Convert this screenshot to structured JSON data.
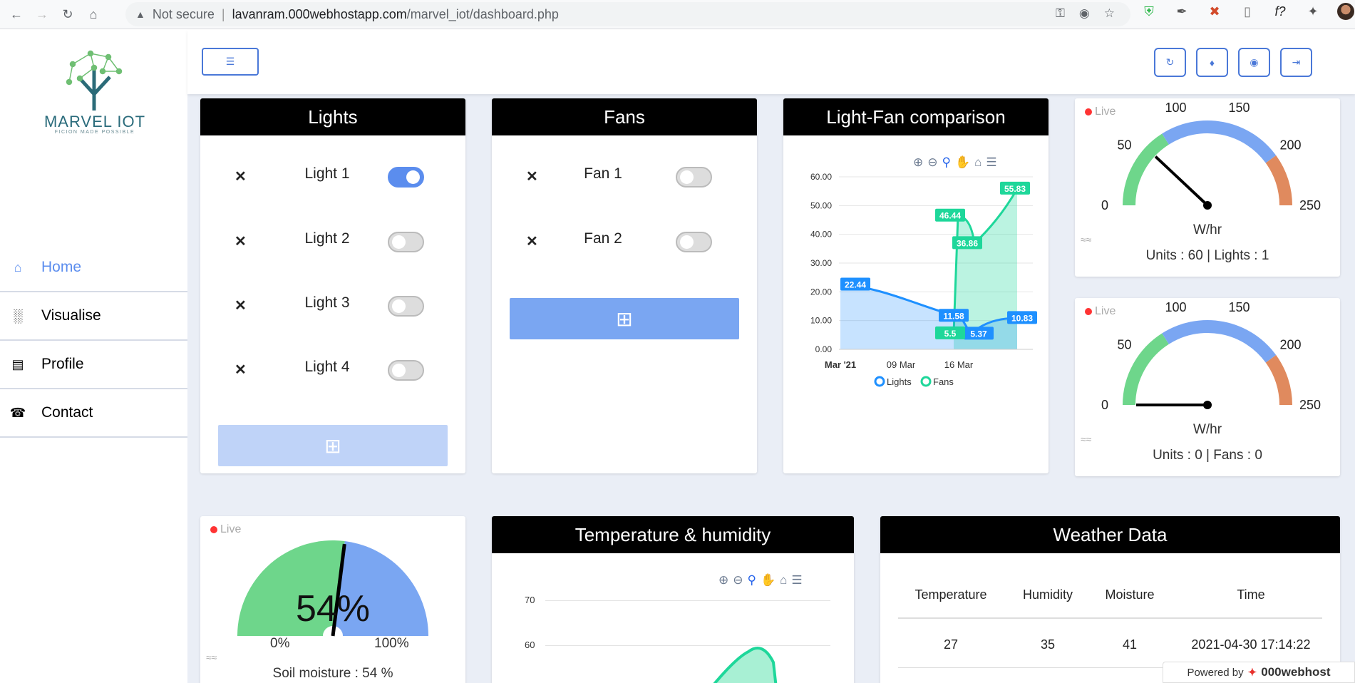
{
  "browser": {
    "security_label": "Not secure",
    "url_host": "lavanram.000webhostapp.com",
    "url_path": "/marvel_iot/dashboard.php"
  },
  "brand": {
    "name": "MARVEL IOT",
    "tagline": "FICION MADE POSSIBLE"
  },
  "sidebar": {
    "items": [
      {
        "label": "Home",
        "icon": "home-icon",
        "active": true
      },
      {
        "label": "Visualise",
        "icon": "bar-chart-icon",
        "active": false
      },
      {
        "label": "Profile",
        "icon": "id-card-icon",
        "active": false
      },
      {
        "label": "Contact",
        "icon": "phone-icon",
        "active": false
      }
    ]
  },
  "lights": {
    "title": "Lights",
    "items": [
      {
        "label": "Light 1",
        "on": true
      },
      {
        "label": "Light 2",
        "on": false
      },
      {
        "label": "Light 3",
        "on": false
      },
      {
        "label": "Light 4",
        "on": false
      }
    ]
  },
  "fans": {
    "title": "Fans",
    "items": [
      {
        "label": "Fan 1",
        "on": false
      },
      {
        "label": "Fan 2",
        "on": false
      }
    ]
  },
  "comparison": {
    "title": "Light-Fan comparison"
  },
  "gauge1": {
    "live": "Live",
    "unit": "W/hr",
    "footer": "Units : 60 | Lights : 1",
    "value": 60,
    "ticks": [
      "0",
      "50",
      "100",
      "150",
      "200",
      "250"
    ]
  },
  "gauge2": {
    "live": "Live",
    "unit": "W/hr",
    "footer": "Units : 0 | Fans : 0",
    "value": 0,
    "ticks": [
      "0",
      "50",
      "100",
      "150",
      "200",
      "250"
    ]
  },
  "soil": {
    "live": "Live",
    "value_label": "54%",
    "min_label": "0%",
    "max_label": "100%",
    "value": 54,
    "footer": "Soil moisture : 54 %"
  },
  "temp_humidity": {
    "title": "Temperature & humidity",
    "y_ticks": [
      "70",
      "60"
    ]
  },
  "weather": {
    "title": "Weather Data",
    "headers": [
      "Temperature",
      "Humidity",
      "Moisture",
      "Time"
    ],
    "rows": [
      [
        "27",
        "35",
        "41",
        "2021-04-30 17:14:22"
      ]
    ]
  },
  "powered_by": {
    "label": "Powered by",
    "brand": "000webhost"
  },
  "colors": {
    "accent": "#5b8dee",
    "lights_series": "#1e90ff",
    "fans_series": "#1ed79a"
  },
  "chart_data": [
    {
      "type": "area",
      "title": "",
      "x": [
        "Mar '21",
        "09 Mar",
        "16 Mar"
      ],
      "y_ticks": [
        "0.00",
        "10.00",
        "20.00",
        "30.00",
        "40.00",
        "50.00",
        "60.00"
      ],
      "ylim": [
        0,
        60
      ],
      "series": [
        {
          "name": "Lights",
          "points": [
            {
              "label": "22.44",
              "y": 22.44
            },
            {
              "label": "11.58",
              "y": 11.58
            },
            {
              "label": "5.37",
              "y": 5.37
            },
            {
              "label": "10.83",
              "y": 10.83
            }
          ]
        },
        {
          "name": "Fans",
          "points": [
            {
              "label": "5.5",
              "y": 5.5
            },
            {
              "label": "46.44",
              "y": 46.44
            },
            {
              "label": "36.86",
              "y": 36.86
            },
            {
              "label": "55.83",
              "y": 55.83
            }
          ]
        }
      ],
      "legend": [
        "Lights",
        "Fans"
      ]
    }
  ]
}
